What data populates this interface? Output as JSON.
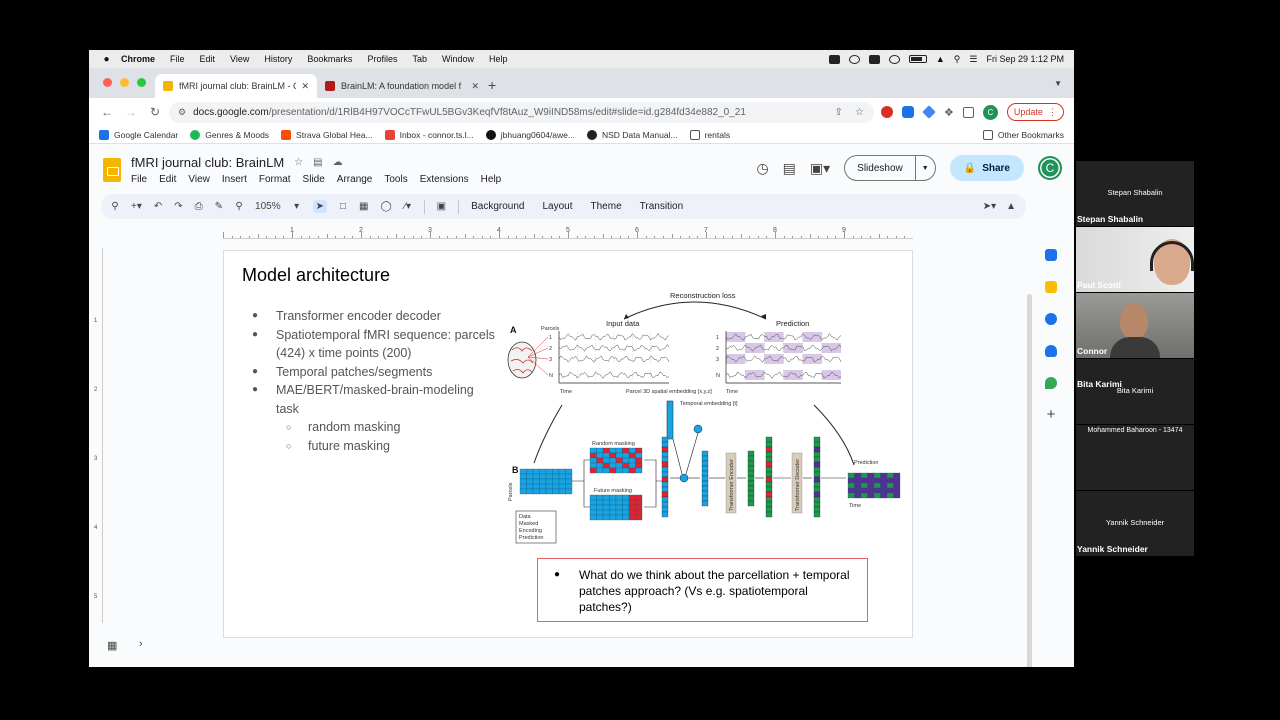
{
  "mac_menu": {
    "app": "Chrome",
    "items": [
      "File",
      "Edit",
      "View",
      "History",
      "Bookmarks",
      "Profiles",
      "Tab",
      "Window",
      "Help"
    ],
    "clock": "Fri Sep 29  1:12 PM"
  },
  "browser": {
    "tabs": [
      {
        "title": "fMRI journal club: BrainLM - G",
        "active": true
      },
      {
        "title": "BrainLM: A foundation model f",
        "active": false
      }
    ],
    "url_host": "docs.google.com",
    "url_path": "/presentation/d/1RlB4H97VOCcTFwUL5BGv3KeqfVf8tAuz_W9iIND58ms/edit#slide=id.g284fd34e882_0_21",
    "update_label": "Update",
    "profile_initial": "C",
    "bookmarks": [
      "Google Calendar",
      "Genres & Moods",
      "Strava Global Hea...",
      "Inbox - connor.ts.l...",
      "jbhuang0604/awe...",
      "NSD Data Manual...",
      "rentals"
    ],
    "other_bookmarks": "Other Bookmarks"
  },
  "slides_app": {
    "doc_title": "fMRI journal club: BrainLM",
    "menus": [
      "File",
      "Edit",
      "View",
      "Insert",
      "Format",
      "Slide",
      "Arrange",
      "Tools",
      "Extensions",
      "Help"
    ],
    "slideshow_label": "Slideshow",
    "share_label": "Share",
    "avatar_initial": "C",
    "zoom": "105%",
    "toolbar_text": [
      "Background",
      "Layout",
      "Theme",
      "Transition"
    ],
    "ruler_numbers": [
      "1",
      "2",
      "3",
      "4",
      "5",
      "6",
      "7",
      "8",
      "9"
    ],
    "ruler_left_numbers": [
      "1",
      "2",
      "3",
      "4",
      "5"
    ]
  },
  "slide": {
    "title": "Model architecture",
    "bullets": [
      {
        "level": 1,
        "text": "Transformer encoder decoder"
      },
      {
        "level": 1,
        "text": "Spatiotemporal fMRI sequence: parcels (424) x time points (200)"
      },
      {
        "level": 1,
        "text": "Temporal patches/segments"
      },
      {
        "level": 1,
        "text": "MAE/BERT/masked-brain-modeling task"
      },
      {
        "level": 2,
        "text": "random masking"
      },
      {
        "level": 2,
        "text": "future masking"
      }
    ],
    "callout": "What do we think about the parcellation + temporal patches approach? (Vs e.g. spatiotemporal patches?)",
    "figure": {
      "recon_loss": "Reconstruction loss",
      "input_data": "Input data",
      "prediction": "Prediction",
      "panel_a": "A",
      "panel_b": "B",
      "parcels": "Parcels",
      "time": "Time",
      "row_labels": [
        "1",
        "2",
        "3",
        "N"
      ],
      "spatial_emb": "Parcel 3D spatial embedding [x,y,z]",
      "temporal_emb": "Temporal embedding [t]",
      "random_masking": "Random masking",
      "future_masking": "Future masking",
      "encoder": "Transformer Encoder",
      "decoder": "Transformer Decoder",
      "prediction_b": "Prediction",
      "legend": [
        "Data",
        "Masked",
        "Encoding",
        "Prediction"
      ],
      "colors": {
        "data": "#1aa3e0",
        "masked": "#e0242f",
        "encoding": "#1e9a4a",
        "prediction": "#5a2d91"
      }
    }
  },
  "zoom": {
    "participants": [
      {
        "name": "Stepan Shabalin",
        "video": false
      },
      {
        "name": "Paul Scotti",
        "video": true
      },
      {
        "name": "Connor",
        "video": true
      },
      {
        "name": "Bita Karimi",
        "video": false
      },
      {
        "name": "Mohammed Baharoon - 13474",
        "video": false
      },
      {
        "name": "Yannik Schneider",
        "video": false
      }
    ]
  }
}
